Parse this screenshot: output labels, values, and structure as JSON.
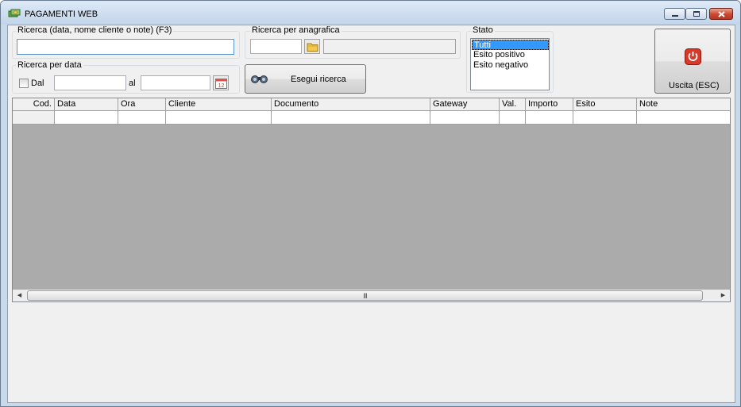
{
  "window": {
    "title": "PAGAMENTI WEB",
    "controls": {
      "minimize_icon": "minimize-icon",
      "maximize_icon": "maximize-icon",
      "close_icon": "close-icon"
    }
  },
  "search_text": {
    "label": "Ricerca (data, nome cliente o note) (F3)",
    "value": ""
  },
  "search_anagrafica": {
    "label": "Ricerca per anagrafica",
    "code_value": "",
    "name_value": "",
    "browse_icon": "folder-icon"
  },
  "search_date": {
    "label": "Ricerca per data",
    "enable_label": "Dal",
    "enabled": false,
    "from_value": "",
    "to_label": "al",
    "to_value": "",
    "calendar_icon": "calendar-icon",
    "calendar_day": "12"
  },
  "run_search": {
    "label": "Esegui ricerca",
    "icon": "binoculars-icon"
  },
  "stato": {
    "label": "Stato",
    "options": [
      "Tutti",
      "Esito positivo",
      "Esito negativo"
    ],
    "selected": "Tutti"
  },
  "exit": {
    "label": "Uscita (ESC)",
    "icon": "power-icon",
    "accent": "#d83a2a"
  },
  "table": {
    "columns": [
      "Cod.",
      "Data",
      "Ora",
      "Cliente",
      "Documento",
      "Gateway",
      "Val.",
      "Importo",
      "Esito",
      "Note"
    ],
    "rows": [
      [
        "",
        "",
        "",
        "",
        "",
        "",
        "",
        "",
        "",
        ""
      ]
    ],
    "empty_area_color": "#ababab"
  },
  "hscroll": {
    "grip": "III"
  }
}
